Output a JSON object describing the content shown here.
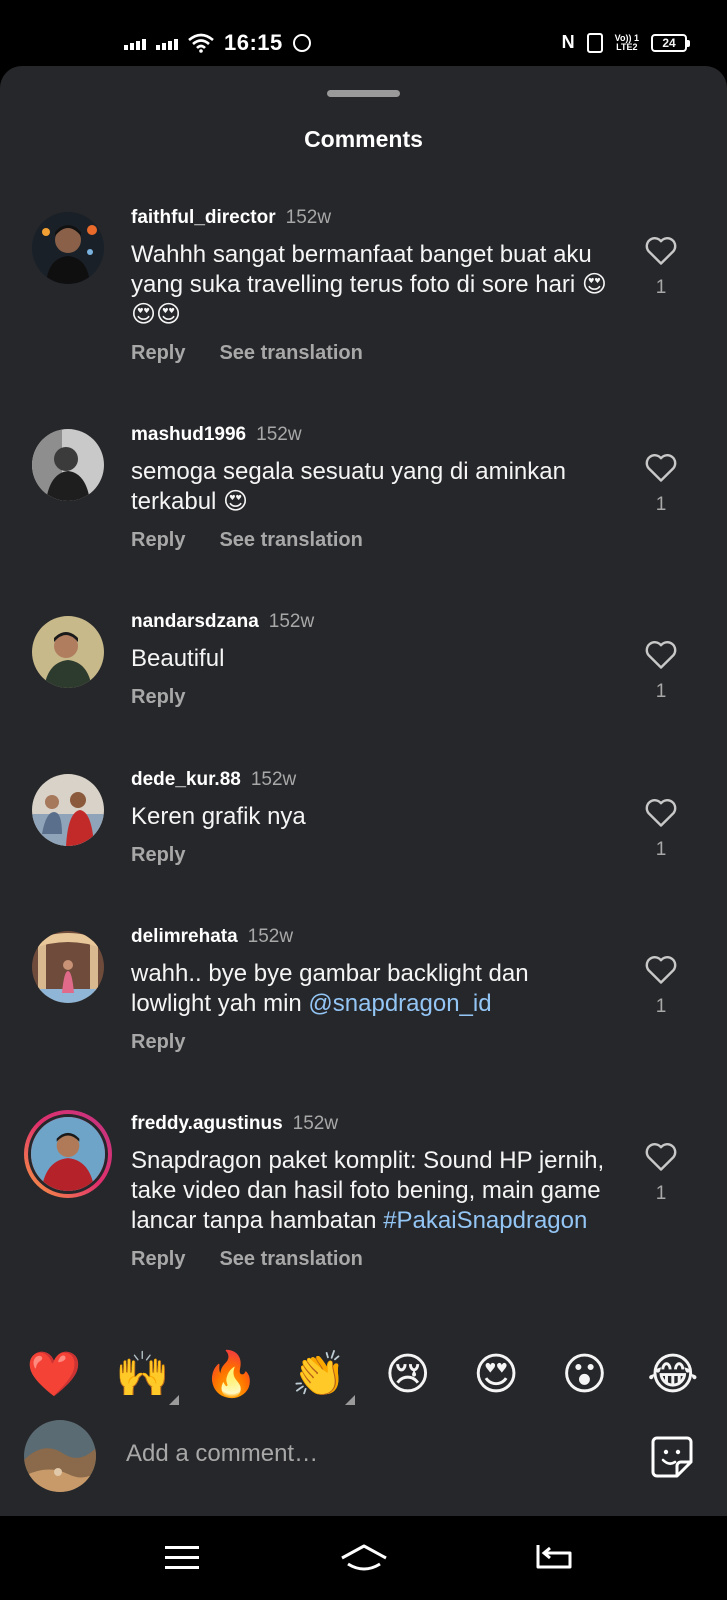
{
  "status": {
    "time": "16:15",
    "nfc": "N",
    "lte": "Vo)) 1\nLTE2",
    "battery": "24"
  },
  "sheet": {
    "title": "Comments"
  },
  "comments": [
    {
      "username": "faithful_director",
      "time": "152w",
      "text": "Wahhh sangat bermanfaat banget buat aku yang suka travelling terus foto di sore hari 😍😍😍",
      "reply_label": "Reply",
      "translate_label": "See translation",
      "likes": "1"
    },
    {
      "username": "mashud1996",
      "time": "152w",
      "text": "semoga segala sesuatu yang di aminkan terkabul 😍",
      "reply_label": "Reply",
      "translate_label": "See translation",
      "likes": "1"
    },
    {
      "username": "nandarsdzana",
      "time": "152w",
      "text": "Beautiful",
      "reply_label": "Reply",
      "likes": "1"
    },
    {
      "username": "dede_kur.88",
      "time": "152w",
      "text": "Keren grafik nya",
      "reply_label": "Reply",
      "likes": "1"
    },
    {
      "username": "delimrehata",
      "time": "152w",
      "text_before": "wahh.. bye bye gambar backlight dan lowlight yah min ",
      "mention": "@snapdragon_id",
      "reply_label": "Reply",
      "likes": "1"
    },
    {
      "username": "freddy.agustinus",
      "time": "152w",
      "text_before": "Snapdragon paket komplit: Sound HP jernih, take video dan hasil foto bening, main game lancar tanpa hambatan ",
      "hashtag": "#PakaiSnapdragon",
      "reply_label": "Reply",
      "translate_label": "See translation",
      "likes": "1"
    }
  ],
  "emoji_bar": [
    "❤️",
    "🙌",
    "🔥",
    "👏",
    "😢",
    "😍",
    "😮",
    "😂"
  ],
  "compose": {
    "placeholder": "Add a comment…"
  },
  "colors": {
    "sheet_bg": "#26272a",
    "mention": "#93c5f5",
    "muted": "#a8a8a8"
  }
}
